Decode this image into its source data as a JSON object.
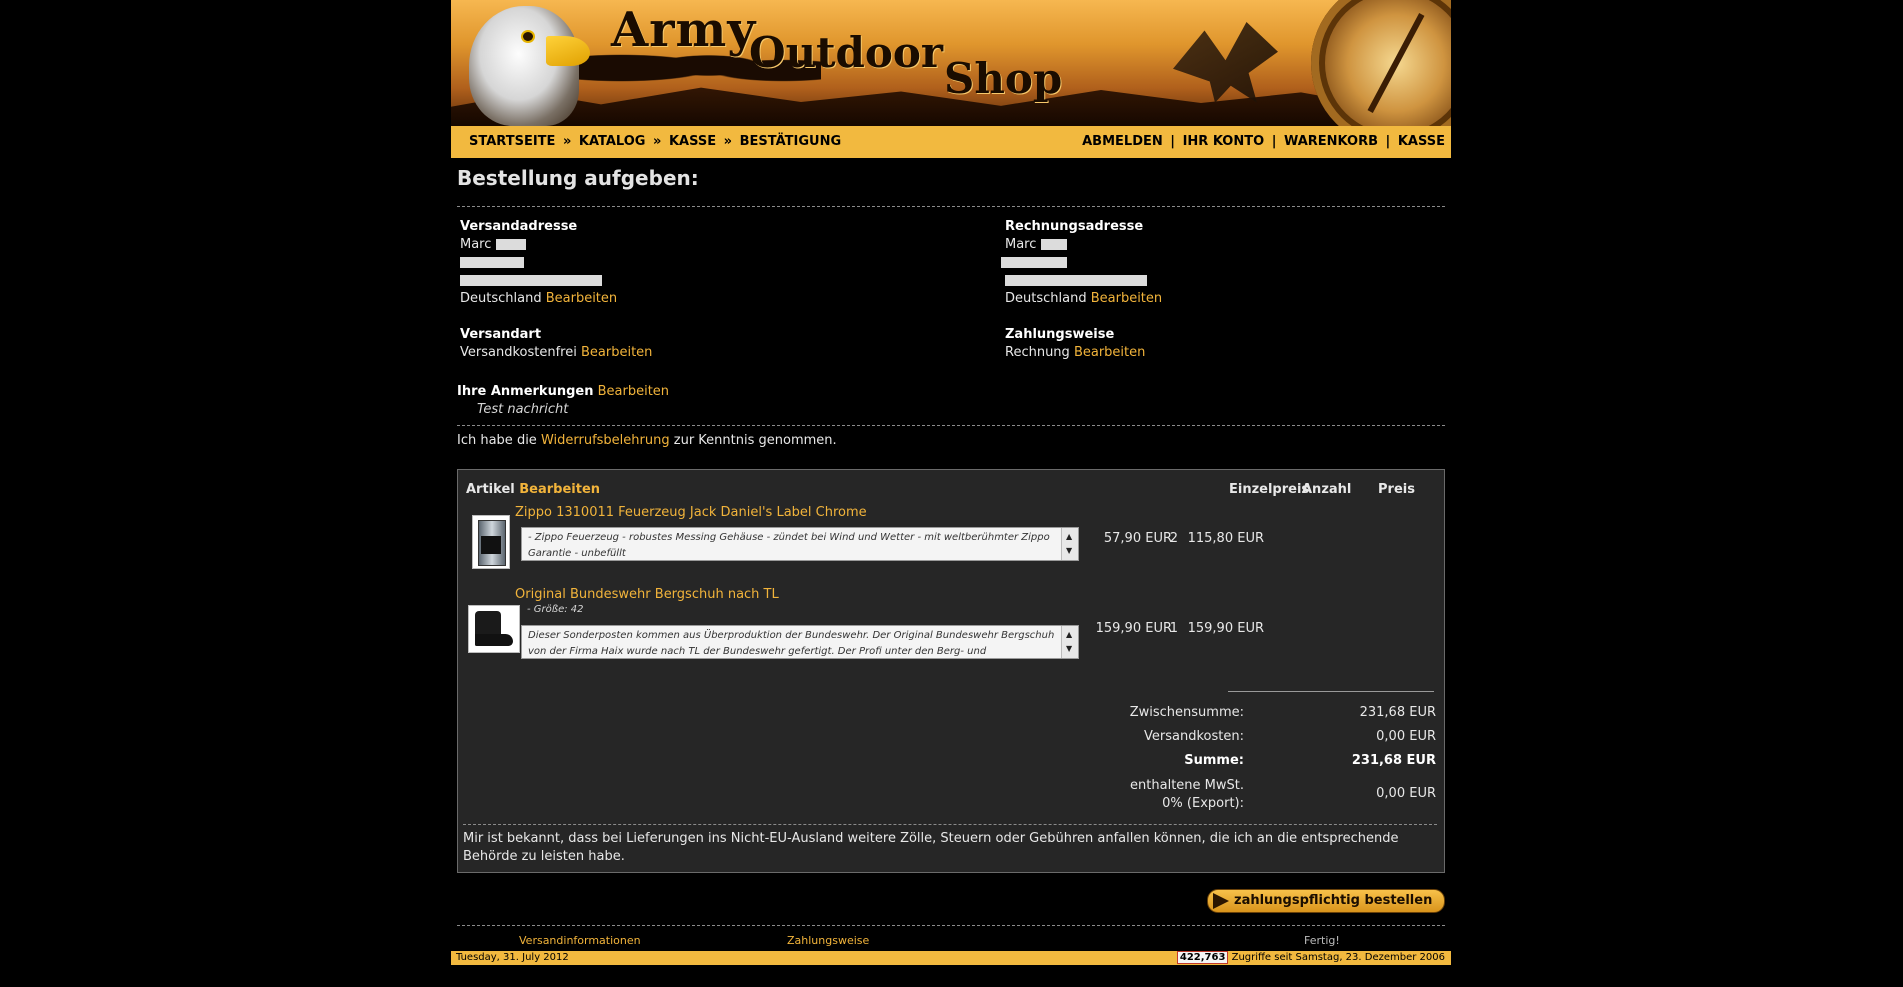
{
  "header": {
    "logo": {
      "line1": "Army",
      "line2": "Outdoor",
      "line3": "Shop"
    }
  },
  "breadcrumb": [
    "STARTSEITE",
    "KATALOG",
    "KASSE",
    "BESTÄTIGUNG"
  ],
  "breadcrumb_separator": "»",
  "top_nav": [
    "ABMELDEN",
    "IHR KONTO",
    "WARENKORB",
    "KASSE"
  ],
  "top_nav_separator": "|",
  "page_title": "Bestellung aufgeben:",
  "edit_label": "Bearbeiten",
  "shipping_address": {
    "heading": "Versandadresse",
    "name": "Marc",
    "country": "Deutschland"
  },
  "billing_address": {
    "heading": "Rechnungsadresse",
    "name": "Marc",
    "country": "Deutschland"
  },
  "shipping_method": {
    "heading": "Versandart",
    "value": "Versandkostenfrei"
  },
  "payment_method": {
    "heading": "Zahlungsweise",
    "value": "Rechnung"
  },
  "comments": {
    "heading": "Ihre Anmerkungen",
    "value": "Test nachricht"
  },
  "withdrawal": {
    "before": "Ich habe die",
    "link": "Widerrufsbelehrung",
    "after": "zur Kenntnis genommen."
  },
  "order_table": {
    "headers": {
      "article": "Artikel",
      "unit_price": "Einzelpreis",
      "qty": "Anzahl",
      "price": "Preis"
    },
    "items": [
      {
        "name": "Zippo 1310011 Feuerzeug Jack Daniel's Label Chrome",
        "option": "",
        "description": "- Zippo Feuerzeug - robustes Messing Gehäuse - zündet bei Wind und Wetter - mit weltberühmter Zippo Garantie - unbefüllt",
        "unit_price": "57,90 EUR",
        "qty": "2",
        "price": "115,80 EUR",
        "thumb_icon": "zippo-lighter-icon"
      },
      {
        "name": "Original Bundeswehr Bergschuh nach TL",
        "option": "- Größe: 42",
        "description": "Dieser Sonderposten kommen aus Überproduktion der Bundeswehr. Der Original Bundeswehr Bergschuh von der Firma Haix wurde nach TL der Bundeswehr gefertigt. Der Profi unter den Berg- und Wanderschuhen mit stabilem Bodenaufbau, BUND-",
        "unit_price": "159,90 EUR",
        "qty": "1",
        "price": "159,90 EUR",
        "thumb_icon": "boot-icon"
      }
    ],
    "totals": {
      "subtotal_label": "Zwischensumme:",
      "subtotal": "231,68 EUR",
      "shipping_label": "Versandkosten:",
      "shipping": "0,00 EUR",
      "sum_label": "Summe:",
      "sum": "231,68 EUR",
      "vat_label_1": "enthaltene MwSt.",
      "vat_label_2": "0% (Export):",
      "vat": "0,00 EUR"
    },
    "notice": "Mir ist bekannt, dass bei Lieferungen ins Nicht-EU-Ausland weitere Zölle, Steuern oder Gebühren anfallen können, die ich an die entsprechende Behörde zu leisten habe."
  },
  "order_button": "zahlungspflichtig bestellen",
  "footer_links": [
    "Versandinformationen",
    "Zahlungsweise"
  ],
  "footer_status": "Fertig!",
  "status_bar": {
    "date": "Tuesday, 31. July 2012",
    "counter": "422,763",
    "counter_text": "Zugriffe seit Samstag, 23. Dezember 2006"
  },
  "colors": {
    "accent": "#f2b93f",
    "link": "#f2b43b",
    "background": "#000000",
    "panel": "#262626"
  }
}
